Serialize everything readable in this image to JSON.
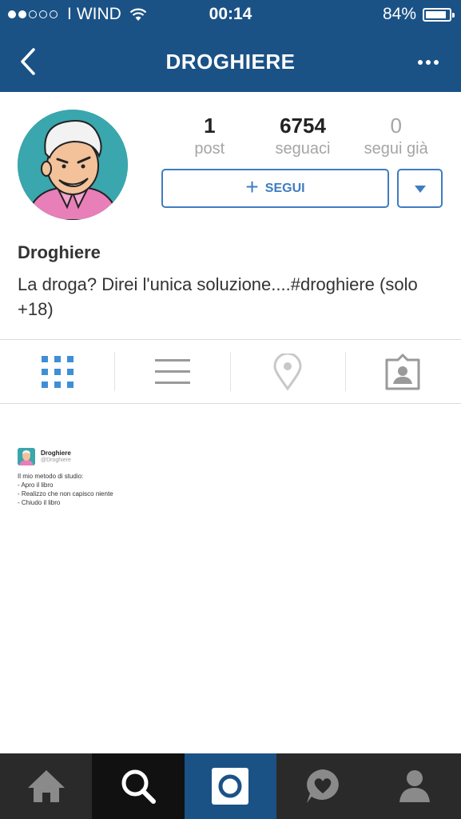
{
  "status_bar": {
    "carrier": "WIND",
    "time": "00:14",
    "battery": "84%",
    "signal_bars_filled": 2,
    "signal_bars_total": 5
  },
  "nav": {
    "title": "DROGHIERE",
    "back_icon": "chevron-left-icon",
    "more_icon": "more-dots-icon"
  },
  "profile": {
    "stats": [
      {
        "value": "1",
        "label": "post"
      },
      {
        "value": "6754",
        "label": "seguaci"
      },
      {
        "value": "0",
        "label": "segui già"
      }
    ],
    "follow_label": "SEGUI",
    "name": "Droghiere",
    "bio": "La droga? Direi l'unica soluzione....#droghiere (solo +18)"
  },
  "tabs": [
    {
      "icon": "grid-icon",
      "active": true
    },
    {
      "icon": "list-icon",
      "active": false
    },
    {
      "icon": "location-pin-icon",
      "active": false
    },
    {
      "icon": "tagged-photos-icon",
      "active": false
    }
  ],
  "post": {
    "author_name": "Droghiere",
    "author_handle": "@Droghiere",
    "lines": [
      "Il mio metodo di studio:",
      "- Apro il libro",
      "- Realizzo che non capisco niente",
      "- Chiudo il libro"
    ]
  },
  "bottom_nav": [
    {
      "icon": "home-icon"
    },
    {
      "icon": "search-icon",
      "active": true
    },
    {
      "icon": "camera-icon"
    },
    {
      "icon": "activity-heart-icon"
    },
    {
      "icon": "profile-icon"
    }
  ],
  "colors": {
    "header_bg": "#1b5286",
    "accent": "#3f7cc1",
    "bottom_bar": "#2a2a2a"
  }
}
